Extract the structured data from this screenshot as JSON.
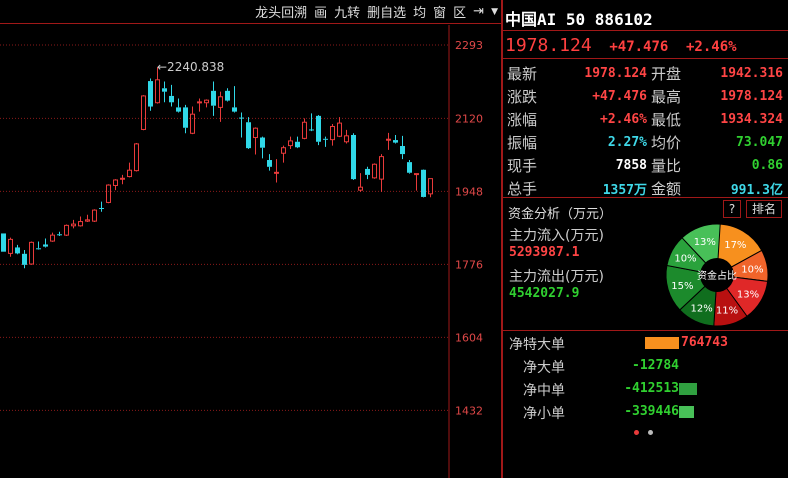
{
  "toolbar": {
    "items": [
      "龙头回溯",
      "画",
      "九转",
      "删自选",
      "均",
      "窗",
      "区"
    ],
    "expand_icon": "collapse-right-icon",
    "dropdown_icon": "chevron-down-icon"
  },
  "quote": {
    "title": "中国AI 50 886102",
    "price": "1978.124",
    "change": "+47.476",
    "change_pct": "+2.46%"
  },
  "stats": [
    {
      "label": "最新",
      "value": "1978.124",
      "color": "red",
      "label2": "开盘",
      "value2": "1942.316",
      "color2": "red"
    },
    {
      "label": "涨跌",
      "value": "+47.476",
      "color": "red",
      "label2": "最高",
      "value2": "1978.124",
      "color2": "red"
    },
    {
      "label": "涨幅",
      "value": "+2.46%",
      "color": "red",
      "label2": "最低",
      "value2": "1934.324",
      "color2": "red"
    },
    {
      "label": "振幅",
      "value": "2.27%",
      "color": "cyan",
      "label2": "均价",
      "value2": "73.047",
      "color2": "green"
    },
    {
      "label": "现手",
      "value": "7858",
      "color": "white",
      "label2": "量比",
      "value2": "0.86",
      "color2": "green"
    },
    {
      "label": "总手",
      "value": "1357万",
      "color": "cyan",
      "label2": "金额",
      "value2": "991.3亿",
      "color2": "cyan"
    }
  ],
  "funds": {
    "title": "资金分析（万元）",
    "help": "?",
    "rank": "排名",
    "inflow_label": "主力流入(万元)",
    "inflow": "5293987.1",
    "outflow_label": "主力流出(万元)",
    "outflow": "4542027.9",
    "pie_center": "资金占比",
    "pie": [
      {
        "pct": 17,
        "label": "17%",
        "color": "#f7901e"
      },
      {
        "pct": 10,
        "label": "10%",
        "color": "#f0642a"
      },
      {
        "pct": 13,
        "label": "13%",
        "color": "#e02828"
      },
      {
        "pct": 11,
        "label": "11%",
        "color": "#b81010"
      },
      {
        "pct": 12,
        "label": "12%",
        "color": "#106e1e"
      },
      {
        "pct": 15,
        "label": "15%",
        "color": "#1c8a2c"
      },
      {
        "pct": 10,
        "label": "10%",
        "color": "#2aa23c"
      },
      {
        "pct": 13,
        "label": "13%",
        "color": "#48c058"
      }
    ]
  },
  "net": [
    {
      "label": "净特大单",
      "value": "764743",
      "color": "#f7901e",
      "fraction": 1.0,
      "positive": true
    },
    {
      "label": "净大单",
      "value": "-12784",
      "color": "#30c040",
      "fraction": 0.0,
      "positive": false
    },
    {
      "label": "净中单",
      "value": "-412513",
      "color": "#30a040",
      "fraction": 0.54,
      "positive": false
    },
    {
      "label": "净小单",
      "value": "-339446",
      "color": "#48c058",
      "fraction": 0.44,
      "positive": false
    }
  ],
  "pager": {
    "active": 0,
    "count": 2
  },
  "chart_data": {
    "type": "candlestick",
    "ylim": [
      1380,
      2330
    ],
    "yticks": [
      "2293",
      "2120",
      "1948",
      "1776",
      "1604",
      "1432"
    ],
    "ytick_values": [
      2293,
      2120,
      1948,
      1776,
      1604,
      1432
    ],
    "max_label": "←2240.838",
    "up_color": "#e83a3a",
    "down_color": "#30d8e8",
    "candles": [
      [
        1849,
        1849,
        1806,
        1806
      ],
      [
        1802,
        1839,
        1794,
        1835
      ],
      [
        1816,
        1822,
        1800,
        1802
      ],
      [
        1801,
        1810,
        1767,
        1775
      ],
      [
        1777,
        1830,
        1775,
        1828
      ],
      [
        1814,
        1830,
        1811,
        1812
      ],
      [
        1823,
        1837,
        1816,
        1818
      ],
      [
        1831,
        1851,
        1829,
        1845
      ],
      [
        1847,
        1853,
        1843,
        1845
      ],
      [
        1845,
        1870,
        1843,
        1868
      ],
      [
        1867,
        1881,
        1861,
        1871
      ],
      [
        1867,
        1889,
        1865,
        1877
      ],
      [
        1878,
        1893,
        1876,
        1881
      ],
      [
        1878,
        1906,
        1876,
        1904
      ],
      [
        1909,
        1924,
        1900,
        1907
      ],
      [
        1922,
        1965,
        1920,
        1963
      ],
      [
        1962,
        1977,
        1951,
        1975
      ],
      [
        1977,
        1987,
        1965,
        1979
      ],
      [
        1983,
        2016,
        1981,
        1998
      ],
      [
        1997,
        2062,
        1995,
        2060
      ],
      [
        2094,
        2175,
        2092,
        2173
      ],
      [
        2208,
        2214,
        2138,
        2148
      ],
      [
        2157,
        2240.838,
        2155,
        2211
      ],
      [
        2191,
        2207,
        2158,
        2183
      ],
      [
        2173,
        2199,
        2148,
        2158
      ],
      [
        2146,
        2167,
        2134,
        2136
      ],
      [
        2146,
        2152,
        2085,
        2098
      ],
      [
        2085,
        2148,
        2083,
        2130
      ],
      [
        2157,
        2167,
        2136,
        2159
      ],
      [
        2157,
        2165,
        2146,
        2163
      ],
      [
        2185,
        2207,
        2126,
        2150
      ],
      [
        2146,
        2183,
        2112,
        2171
      ],
      [
        2185,
        2191,
        2160,
        2162
      ],
      [
        2146,
        2196,
        2134,
        2136
      ],
      [
        2122,
        2134,
        2075,
        2120
      ],
      [
        2111,
        2123,
        2048,
        2050
      ],
      [
        2075,
        2099,
        2035,
        2097
      ],
      [
        2075,
        2077,
        2026,
        2051
      ],
      [
        2022,
        2036,
        1997,
        2006
      ],
      [
        1991,
        2024,
        1969,
        1993
      ],
      [
        2038,
        2056,
        2016,
        2051
      ],
      [
        2056,
        2077,
        2048,
        2067
      ],
      [
        2065,
        2077,
        2050,
        2052
      ],
      [
        2073,
        2120,
        2071,
        2111
      ],
      [
        2094,
        2132,
        2090,
        2092
      ],
      [
        2126,
        2128,
        2057,
        2065
      ],
      [
        2072,
        2077,
        2053,
        2070
      ],
      [
        2070,
        2107,
        2056,
        2101
      ],
      [
        2078,
        2123,
        2076,
        2109
      ],
      [
        2065,
        2093,
        2061,
        2079
      ],
      [
        2081,
        2085,
        1975,
        1977
      ],
      [
        1951,
        1991,
        1947,
        1958
      ],
      [
        2001,
        2006,
        1977,
        1987
      ],
      [
        1980,
        2014,
        1978,
        2012
      ],
      [
        1977,
        2036,
        1947,
        2030
      ],
      [
        2069,
        2086,
        2046,
        2071
      ],
      [
        2069,
        2081,
        2061,
        2063
      ],
      [
        2055,
        2079,
        2024,
        2036
      ],
      [
        2017,
        2022,
        1990,
        1992
      ],
      [
        1989,
        1990,
        1950,
        1990
      ],
      [
        1999,
        2000,
        1934,
        1935
      ],
      [
        1942.316,
        1978.124,
        1934.324,
        1978.124
      ]
    ]
  }
}
